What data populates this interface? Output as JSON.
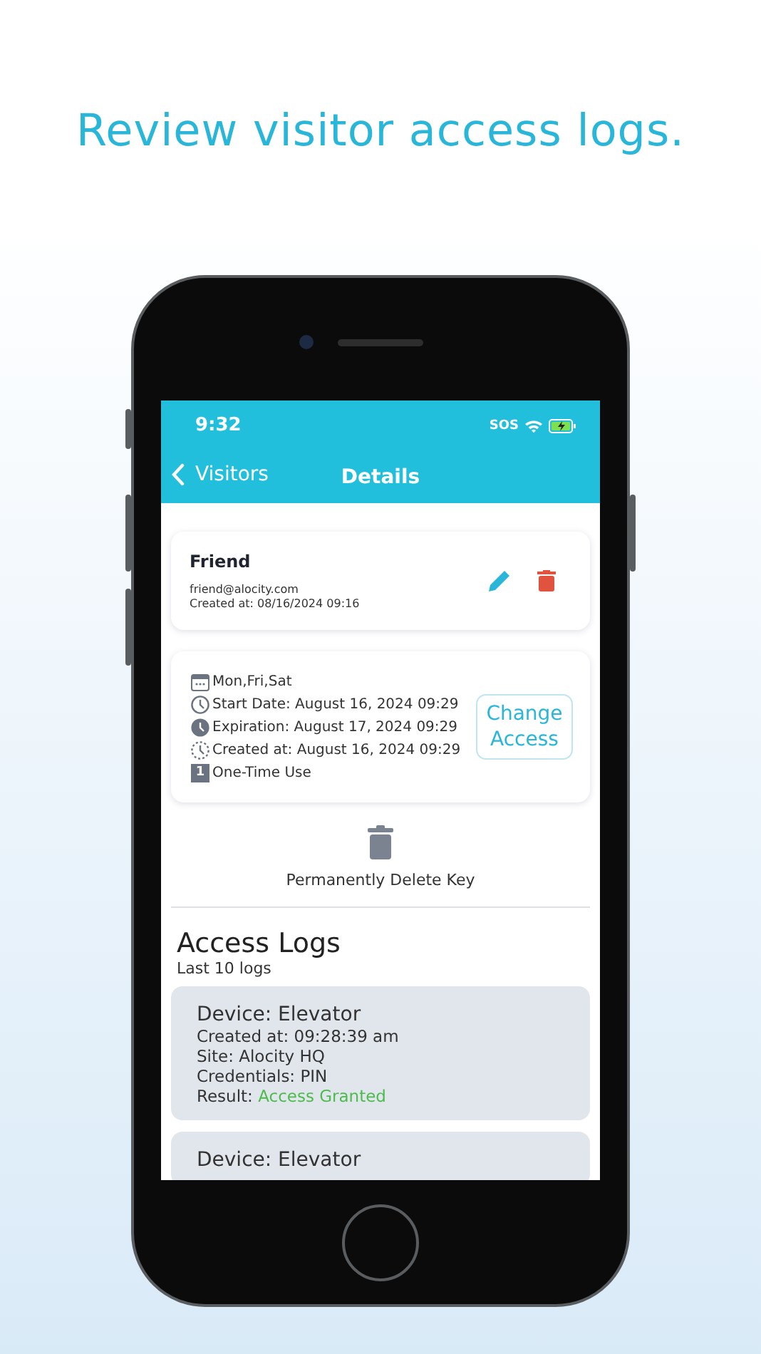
{
  "headline": "Review visitor access logs.",
  "status_bar": {
    "time": "9:32",
    "sos": "SOS",
    "battery_charging": true
  },
  "nav": {
    "back": "Visitors",
    "title": "Details"
  },
  "visitor": {
    "name": "Friend",
    "email": "friend@alocity.com",
    "created": "Created at: 08/16/2024 09:16"
  },
  "access": {
    "rows": [
      {
        "kind": "calendar",
        "text": "Mon,Fri,Sat"
      },
      {
        "kind": "start",
        "text": "Start Date: August 16, 2024 09:29"
      },
      {
        "kind": "expiration",
        "text": "Expiration: August 17, 2024 09:29"
      },
      {
        "kind": "created",
        "text": "Created at: August 16, 2024 09:29"
      },
      {
        "kind": "uses",
        "icon_text": "1",
        "text": "One-Time Use"
      }
    ],
    "button": "Change Access"
  },
  "delete_key": "Permanently Delete Key",
  "logs": {
    "title": "Access Logs",
    "subtitle": "Last 10 logs",
    "items": [
      {
        "device": "Device: Elevator",
        "created": "Created at: 09:28:39 am",
        "site": "Site: Alocity HQ",
        "credentials": "Credentials: PIN",
        "result_label": "Result:",
        "result": "Access Granted",
        "color": "#4cbb4c"
      },
      {
        "device": "Device: Elevator"
      }
    ]
  }
}
